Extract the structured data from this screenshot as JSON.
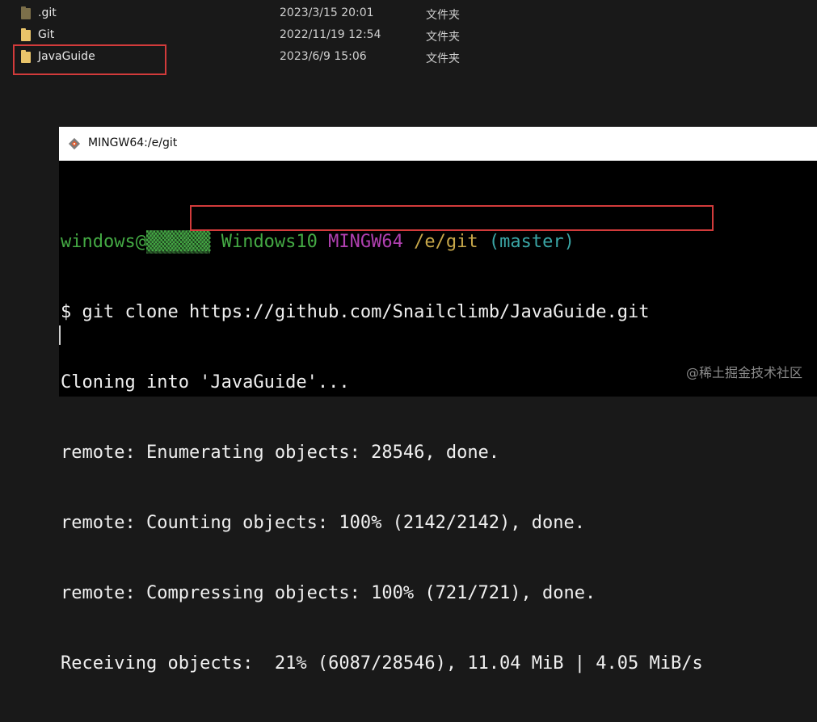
{
  "explorer": {
    "files": [
      {
        "name": ".git",
        "date": "2023/3/15 20:01",
        "type": "文件夹",
        "hidden": true
      },
      {
        "name": "Git",
        "date": "2022/11/19 12:54",
        "type": "文件夹",
        "hidden": false
      },
      {
        "name": "JavaGuide",
        "date": "2023/6/9 15:06",
        "type": "文件夹",
        "hidden": false
      }
    ]
  },
  "terminal": {
    "title": "MINGW64:/e/git",
    "prompt": {
      "user": "windows@",
      "masked": "▒▒▒▒▒▒",
      "host": "Windows10",
      "system": "MINGW64",
      "path": "/e/git",
      "branch": "(master)"
    },
    "command": {
      "prefix": "$ git clone ",
      "url": "https://github.com/Snailclimb/JavaGuide.git"
    },
    "output": [
      "Cloning into 'JavaGuide'...",
      "remote: Enumerating objects: 28546, done.",
      "remote: Counting objects: 100% (2142/2142), done.",
      "remote: Compressing objects: 100% (721/721), done.",
      "Receiving objects:  21% (6087/28546), 11.04 MiB | 4.05 MiB/s"
    ]
  },
  "watermark": "@稀土掘金技术社区",
  "colors": {
    "highlight": "#d23b3b",
    "prompt_green": "#44aa44",
    "prompt_purple": "#b040b0",
    "prompt_yellow": "#c8a84a",
    "prompt_cyan": "#3aa6a6"
  }
}
